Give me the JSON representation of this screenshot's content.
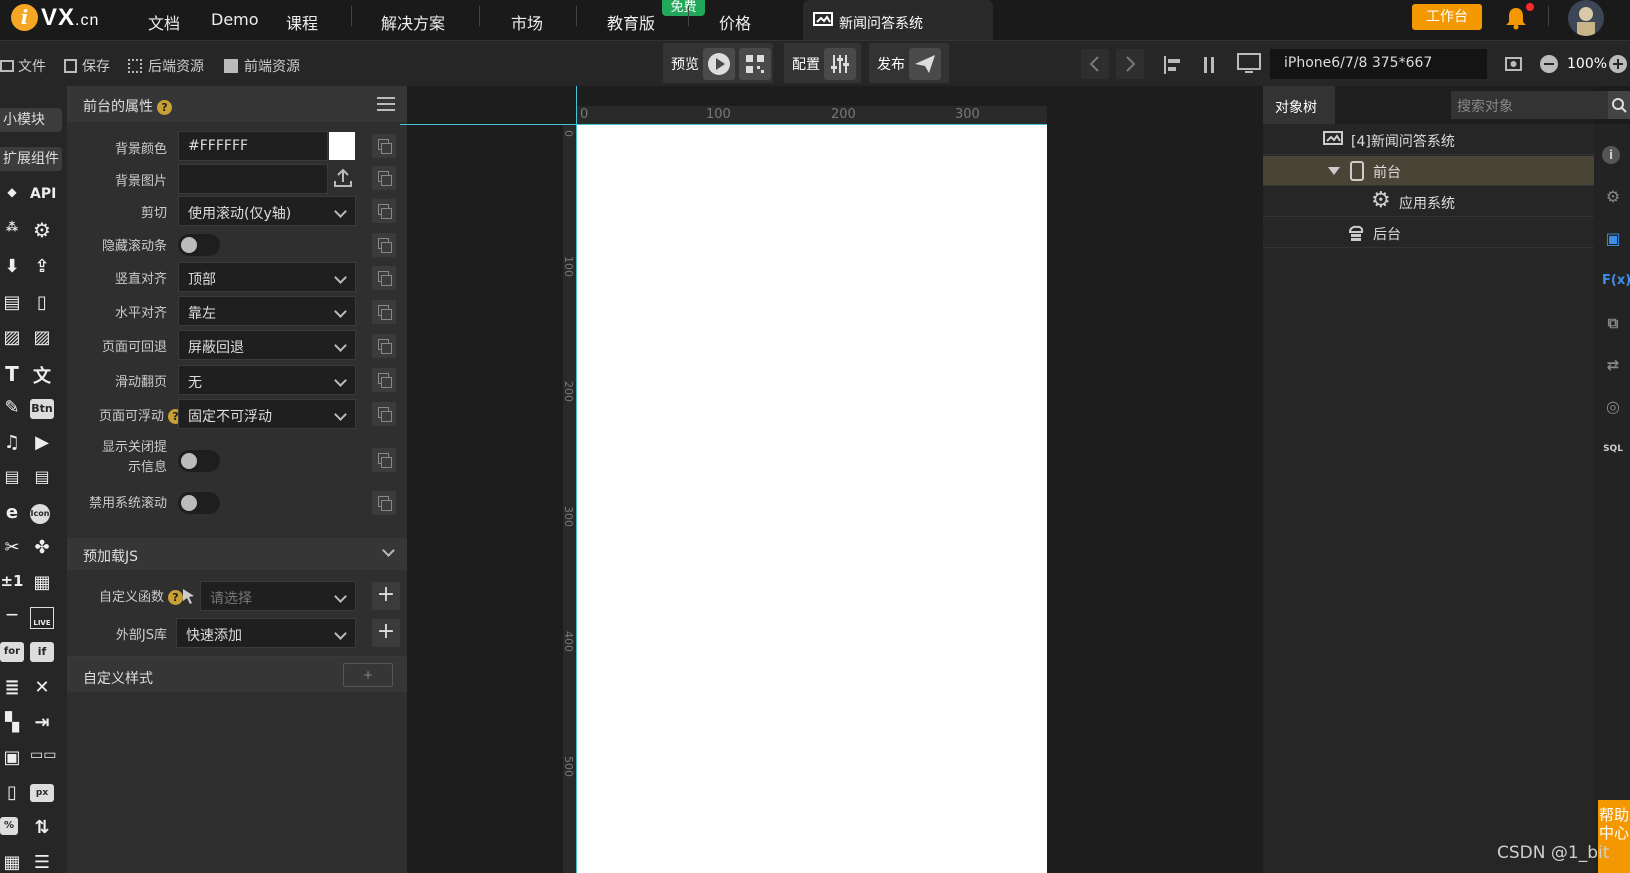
{
  "topnav": {
    "logo_mark": "i",
    "logo_brand": "VX",
    "logo_domain": ".cn",
    "items": [
      "文档",
      "Demo",
      "课程",
      "解决方案",
      "市场",
      "教育版",
      "价格"
    ],
    "free_badge": "免费",
    "doc_tab_title": "新闻问答系统",
    "workbench_label": "工作台",
    "accent_color": "#f39800"
  },
  "toolbar": {
    "file": "文件",
    "save": "保存",
    "backend_resources": "后端资源",
    "frontend_resources": "前端资源",
    "preview": "预览",
    "config": "配置",
    "publish": "发布",
    "device": "iPhone6/7/8 375*667",
    "zoom": "100%"
  },
  "leftstrip": {
    "tab_small_module": "小模块",
    "tab_ext_components": "扩展组件",
    "api_label": "API",
    "btn_label": "Btn",
    "icon_label": "Icon",
    "for_label": "for",
    "if_label": "if",
    "px_label": "px",
    "pct_label": "%",
    "live_label": "LIVE",
    "plusminus_label": "±1"
  },
  "props": {
    "header": "前台的属性",
    "help": "?",
    "rows": [
      {
        "label": "背景颜色",
        "value": "#FFFFFF"
      },
      {
        "label": "背景图片",
        "value": ""
      },
      {
        "label": "剪切",
        "value": "使用滚动(仅y轴)"
      },
      {
        "label": "隐藏滚动条",
        "value": ""
      },
      {
        "label": "竖直对齐",
        "value": "顶部"
      },
      {
        "label": "水平对齐",
        "value": "靠左"
      },
      {
        "label": "页面可回退",
        "value": "屏蔽回退"
      },
      {
        "label": "滑动翻页",
        "value": "无"
      },
      {
        "label": "页面可浮动",
        "value": "固定不可浮动"
      },
      {
        "label": "显示关闭提示信息",
        "value": ""
      },
      {
        "label": "禁用系统滚动",
        "value": ""
      }
    ],
    "preload_header": "预加载JS",
    "custom_func_label": "自定义函数",
    "custom_func_placeholder": "请选择",
    "external_js_label": "外部JS库",
    "external_js_value": "快速添加",
    "custom_style_header": "自定义样式",
    "add_symbol": "+"
  },
  "ruler": {
    "top": [
      "0",
      "100",
      "200",
      "300"
    ],
    "left": [
      "0",
      "100",
      "200",
      "300",
      "400",
      "500"
    ]
  },
  "objecttree": {
    "tab": "对象树",
    "search_placeholder": "搜索对象",
    "nodes": [
      {
        "label": "[4]新闻问答系统"
      },
      {
        "label": "前台"
      },
      {
        "label": "应用系统"
      },
      {
        "label": "后台"
      }
    ]
  },
  "right_sidebar": {
    "fx_label": "F(x)",
    "sql_label": "SQL",
    "info_label": "i"
  },
  "help": "帮助中心",
  "watermark": "CSDN @1_bit"
}
